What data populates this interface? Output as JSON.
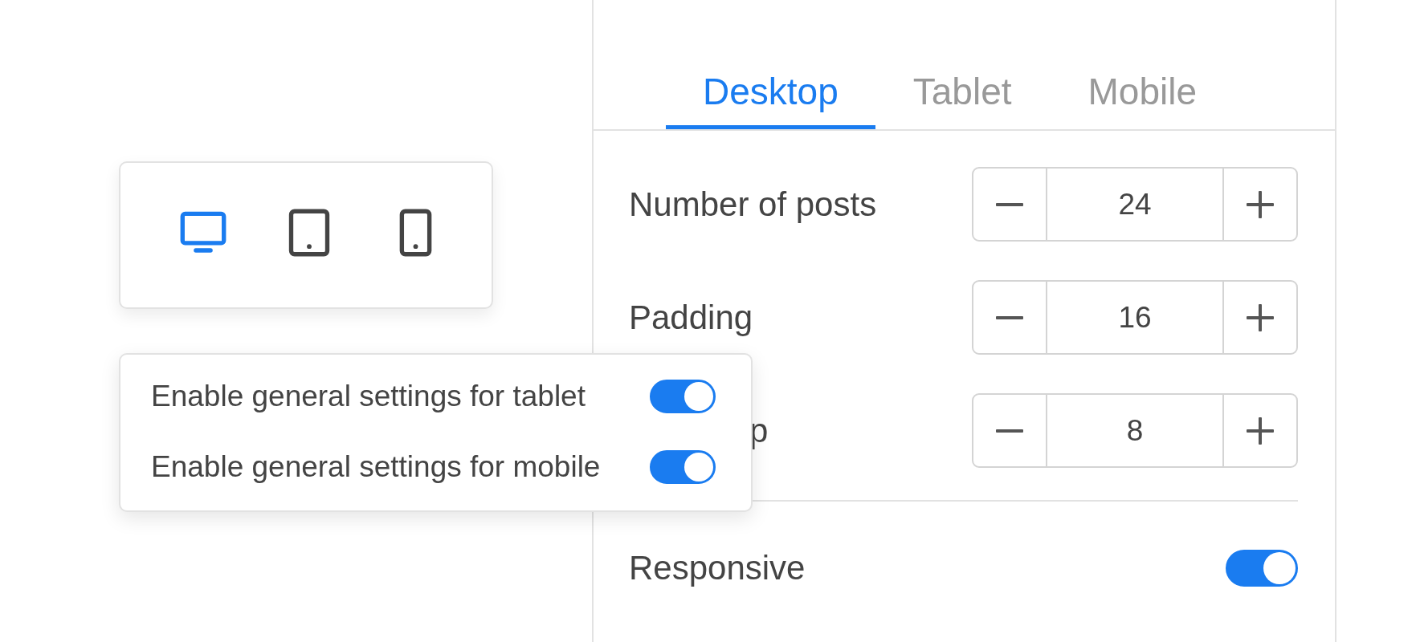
{
  "devices": [
    {
      "kind": "desktop",
      "selected": true
    },
    {
      "kind": "tablet",
      "selected": false
    },
    {
      "kind": "phone",
      "selected": false
    }
  ],
  "popup": {
    "options": [
      {
        "label": "Enable general settings for tablet",
        "on": true
      },
      {
        "label": "Enable general settings for mobile",
        "on": true
      }
    ]
  },
  "tabs": [
    {
      "label": "Desktop",
      "selected": true
    },
    {
      "label": "Tablet",
      "selected": false
    },
    {
      "label": "Mobile",
      "selected": false
    }
  ],
  "settings": [
    {
      "label": "Number of posts",
      "value": "24",
      "covered": false
    },
    {
      "label": "Padding",
      "value": "16",
      "covered": false
    },
    {
      "label": "p",
      "value": "8",
      "covered": true
    }
  ],
  "responsive": {
    "label": "Responsive",
    "on": true
  }
}
